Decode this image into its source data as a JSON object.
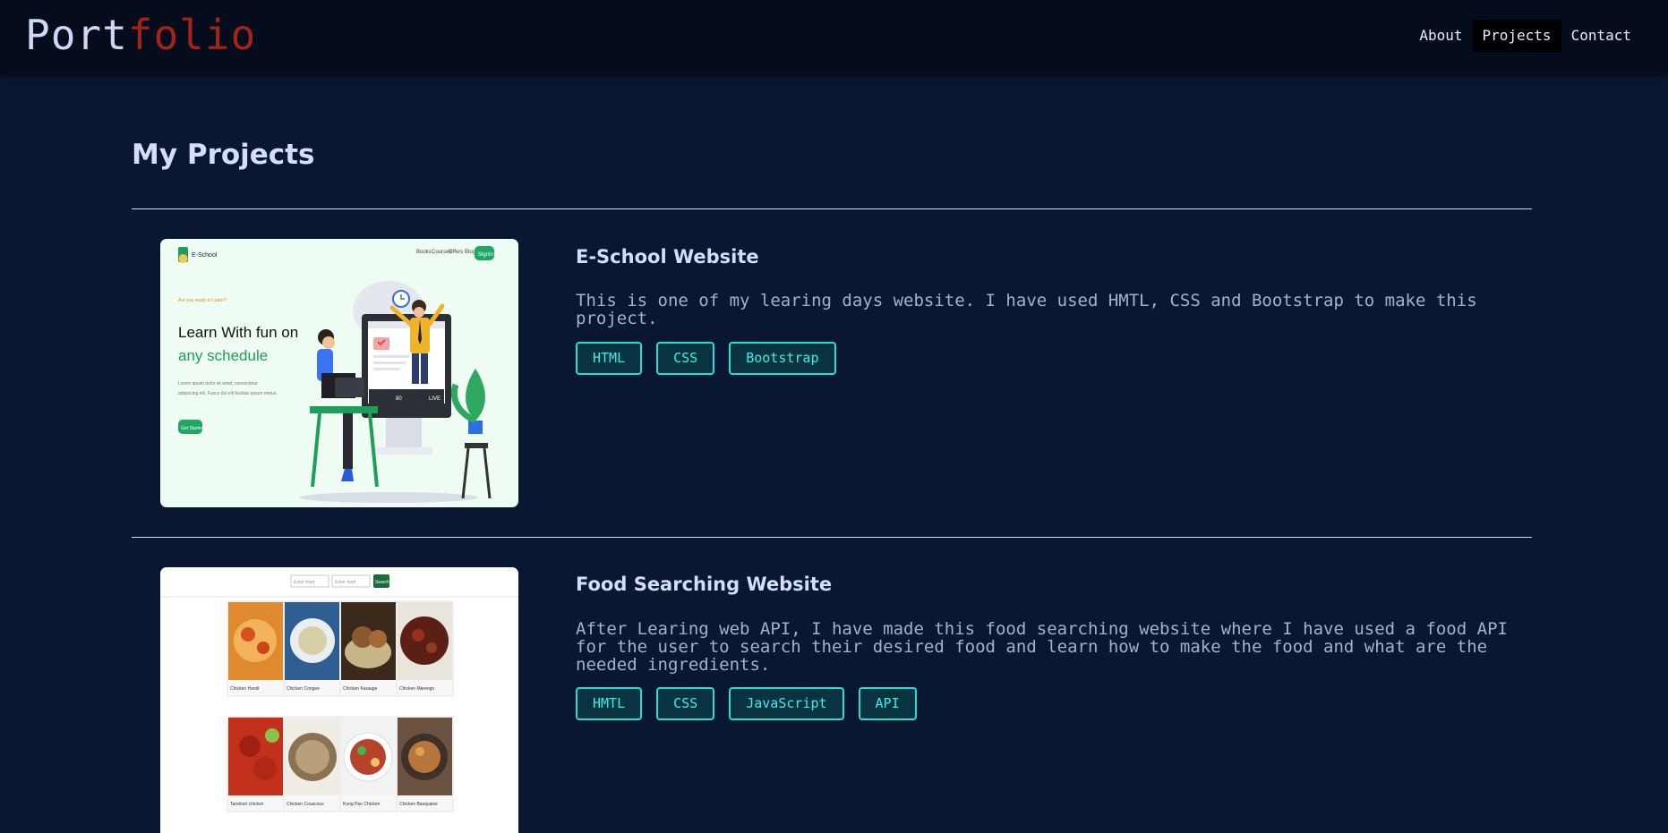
{
  "brand": {
    "part1": "Port",
    "part2": "folio"
  },
  "nav": {
    "about": "About",
    "projects": "Projects",
    "contact": "Contact"
  },
  "page_title": "My Projects",
  "projects": [
    {
      "title": "E-School Website",
      "description": "This is one of my learing days website. I have used HMTL, CSS and Bootstrap to make this project.",
      "tags": [
        "HTML",
        "CSS",
        "Bootstrap"
      ],
      "thumb": {
        "logo": "E-School",
        "nav_items": [
          "Books",
          "Courses",
          "Offers",
          "Blog"
        ],
        "signin": "SignIn",
        "kicker": "Are you ready to Learn?",
        "headline1": "Learn With fun on",
        "headline2": "any schedule",
        "body1": "Lorem ipsum dolor sit amet, consectetur",
        "body2": "adipiscing elit. Fusce dui elit facilisis ipsum metus.",
        "cta": "Get Started",
        "live": "LIVE",
        "count": "80"
      }
    },
    {
      "title": "Food Searching Website",
      "description": "After Learing web API, I have made this food searching website where I have used a food API for the user to search their desired food and learn how to make the food and what are the needed ingredients.",
      "tags": [
        "HMTL",
        "CSS",
        "JavaScript",
        "API"
      ],
      "thumb": {
        "input1": "Enter food",
        "input2": "Enter food",
        "search": "Search",
        "foods": [
          "Chicken Handi",
          "Chicken Congee",
          "Chicken Karaage",
          "Chicken Marengo",
          "Tandoori chicken",
          "Chicken Couscous",
          "Kung Pao Chicken",
          "Chicken Basquaise"
        ]
      }
    }
  ],
  "colors": {
    "background": "#0a1730",
    "navbar": "#050d1d",
    "brand_accent": "#a3231b",
    "tag_border": "#28ddd2",
    "tag_text": "#36f0e3"
  }
}
